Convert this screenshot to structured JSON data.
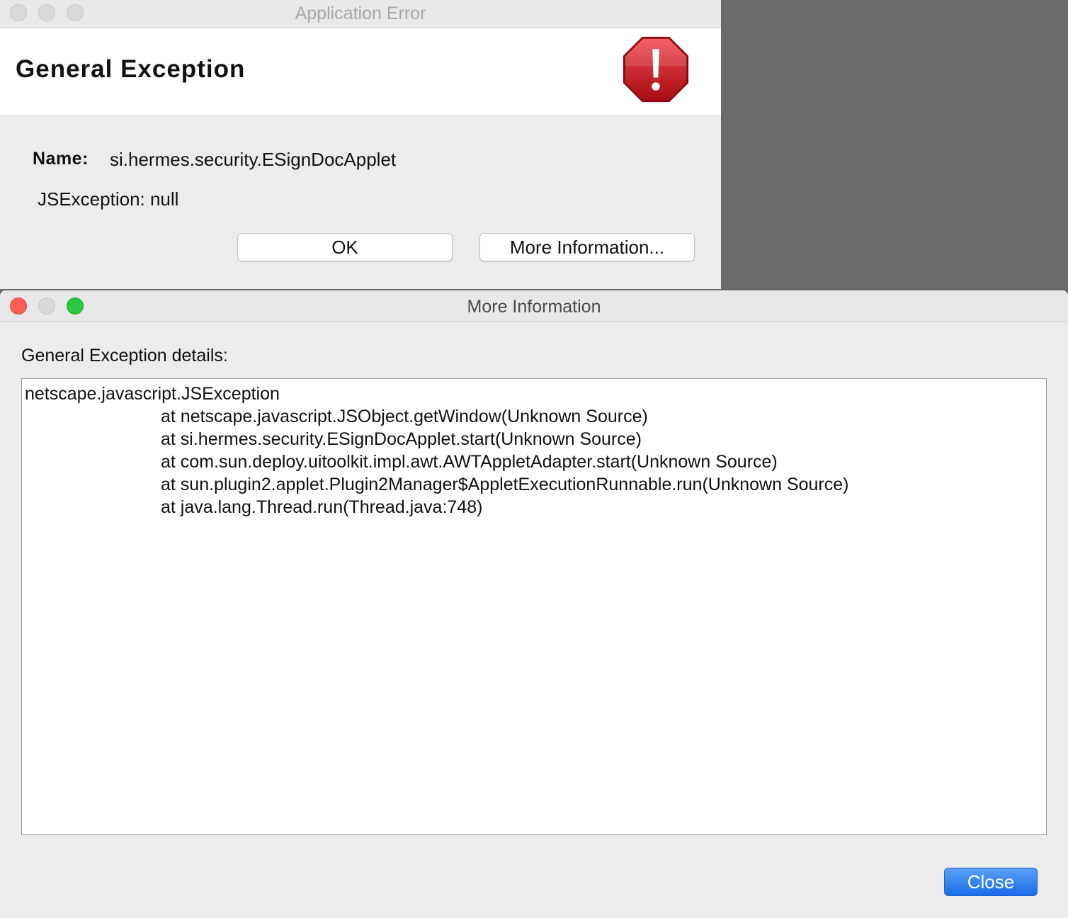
{
  "app_error_window": {
    "title": "Application Error",
    "header_title": "General Exception",
    "icon": "error-stop-icon",
    "name_label": "Name:",
    "name_value": "si.hermes.security.ESignDocApplet",
    "exception_message": "JSException: null",
    "ok_label": "OK",
    "more_info_label": "More Information..."
  },
  "more_info_window": {
    "title": "More Information",
    "details_label": "General Exception details:",
    "trace_head": "netscape.javascript.JSException",
    "trace_lines": [
      "at netscape.javascript.JSObject.getWindow(Unknown Source)",
      "at si.hermes.security.ESignDocApplet.start(Unknown Source)",
      "at com.sun.deploy.uitoolkit.impl.awt.AWTAppletAdapter.start(Unknown Source)",
      "at sun.plugin2.applet.Plugin2Manager$AppletExecutionRunnable.run(Unknown Source)",
      "at java.lang.Thread.run(Thread.java:748)"
    ],
    "close_label": "Close"
  },
  "colors": {
    "stop_red": "#c8161d",
    "close_button_blue": "#1b6de8",
    "backdrop": "#6b6b6b"
  }
}
